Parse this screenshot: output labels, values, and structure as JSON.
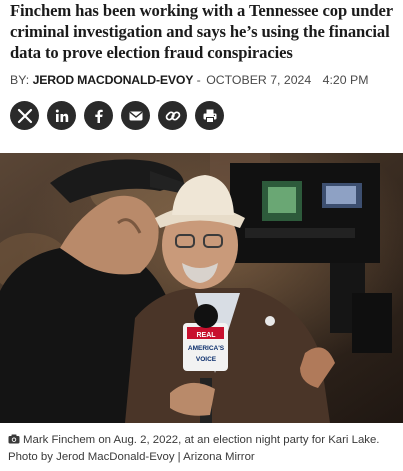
{
  "article": {
    "headline": "Finchem has been working with a Tennessee cop under criminal investigation and says he’s using the financial data to prove election fraud conspiracies",
    "byline": {
      "prefix": "BY:",
      "author": "JEROD MACDONALD-EVOY",
      "separator": "-",
      "date": "OCTOBER 7, 2024",
      "time": "4:20 PM"
    }
  },
  "share": [
    {
      "name": "x",
      "icon": "x-logo-icon"
    },
    {
      "name": "linkedin",
      "icon": "linkedin-icon"
    },
    {
      "name": "facebook",
      "icon": "facebook-icon"
    },
    {
      "name": "email",
      "icon": "envelope-icon"
    },
    {
      "name": "copy-link",
      "icon": "link-icon"
    },
    {
      "name": "print",
      "icon": "printer-icon"
    }
  ],
  "photo": {
    "microphone_flag_lines": [
      "REAL",
      "AMERICA'S",
      "VOICE"
    ]
  },
  "caption": {
    "icon": "camera-icon",
    "text": "Mark Finchem on Aug. 2, 2022, at an election night party for Kari Lake. Photo by Jerod MacDonald-Evoy | Arizona Mirror"
  },
  "colors": {
    "share_button_bg": "#2a2a2a",
    "headline_text": "#1b1b1b",
    "byline_text": "#4a4a4a"
  }
}
